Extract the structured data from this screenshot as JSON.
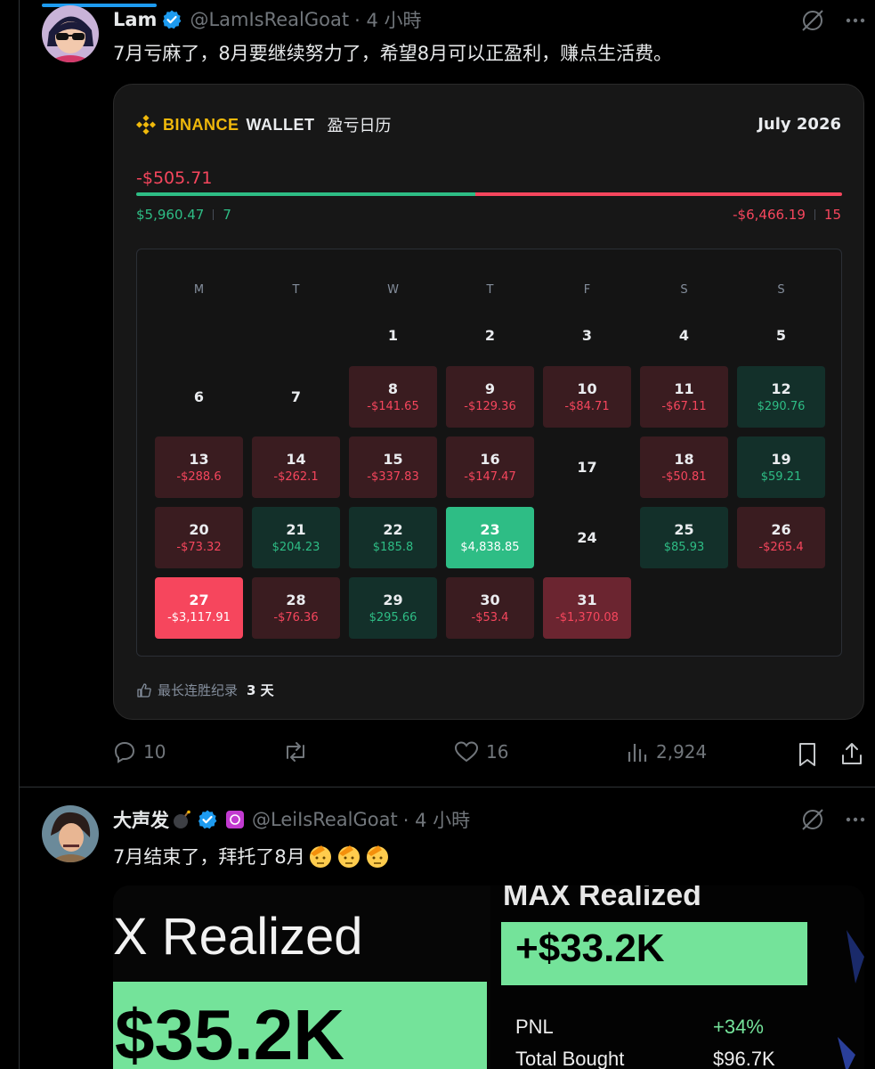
{
  "tweet1": {
    "name": "Lam",
    "handle": "@LamIsRealGoat",
    "time": "· 4 小時",
    "text": "7月亏麻了，8月要继续努力了，希望8月可以正盈利，赚点生活费。",
    "stats": {
      "replies": "10",
      "likes": "16",
      "views": "2,924"
    }
  },
  "card": {
    "brand": "BINANCE",
    "wallet": "WALLET",
    "title": "盈亏日历",
    "month": "July 2026",
    "total": "-$505.71",
    "profit_total": "$5,960.47",
    "profit_days": "7",
    "loss_total": "-$6,466.19",
    "loss_days": "15",
    "weekdays": [
      "M",
      "T",
      "W",
      "T",
      "F",
      "S",
      "S"
    ],
    "streak_label": "最长连胜纪录",
    "streak_value": "3 天",
    "days": [
      {
        "d": "1"
      },
      {
        "d": "2"
      },
      {
        "d": "3"
      },
      {
        "d": "4"
      },
      {
        "d": "5"
      },
      {
        "d": "6"
      },
      {
        "d": "7"
      },
      {
        "d": "8",
        "v": "-$141.65"
      },
      {
        "d": "9",
        "v": "-$129.36"
      },
      {
        "d": "10",
        "v": "-$84.71"
      },
      {
        "d": "11",
        "v": "-$67.11"
      },
      {
        "d": "12",
        "v": "$290.76"
      },
      {
        "d": "13",
        "v": "-$288.6"
      },
      {
        "d": "14",
        "v": "-$262.1"
      },
      {
        "d": "15",
        "v": "-$337.83"
      },
      {
        "d": "16",
        "v": "-$147.47"
      },
      {
        "d": "17"
      },
      {
        "d": "18",
        "v": "-$50.81"
      },
      {
        "d": "19",
        "v": "$59.21"
      },
      {
        "d": "20",
        "v": "-$73.32"
      },
      {
        "d": "21",
        "v": "$204.23"
      },
      {
        "d": "22",
        "v": "$185.8"
      },
      {
        "d": "23",
        "v": "$4,838.85"
      },
      {
        "d": "24"
      },
      {
        "d": "25",
        "v": "$85.93"
      },
      {
        "d": "26",
        "v": "-$265.4"
      },
      {
        "d": "27",
        "v": "-$3,117.91"
      },
      {
        "d": "28",
        "v": "-$76.36"
      },
      {
        "d": "29",
        "v": "$295.66"
      },
      {
        "d": "30",
        "v": "-$53.4"
      },
      {
        "d": "31",
        "v": "-$1,370.08"
      }
    ]
  },
  "tweet2": {
    "name": "大声发",
    "handle": "@LeiIsRealGoat",
    "time": "· 4 小時",
    "text": "7月结束了，拜托了8月",
    "image": {
      "left_title": "X Realized",
      "left_value": "$35.2K",
      "right_title": "MAX Realized",
      "right_value": "+$33.2K",
      "pnl_label": "PNL",
      "pnl_value": "+34%",
      "bought_label": "Total Bought",
      "bought_value": "$96.7K"
    }
  },
  "colors": {
    "binance_yellow": "#f0b90b",
    "profit_green": "#2ebd85",
    "loss_red": "#f6465d",
    "twitter_blue": "#1d9bf0",
    "realized_green": "#6fe3a0"
  }
}
